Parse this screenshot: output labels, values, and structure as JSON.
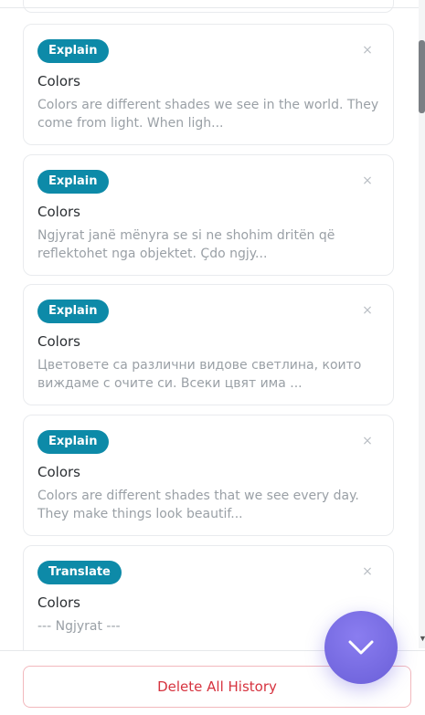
{
  "history": {
    "items": [
      {
        "badge": "Explain",
        "title": "Colors",
        "snippet": "Colors are different shades we see in the world. They come from light. When ligh...",
        "close_glyph": "×"
      },
      {
        "badge": "Explain",
        "title": "Colors",
        "snippet": "Ngjyrat janë mënyra se si ne shohim dritën që reflektohet nga objektet. Çdo ngjy...",
        "close_glyph": "×"
      },
      {
        "badge": "Explain",
        "title": "Colors",
        "snippet": "Цветовете са различни видове светлина, които виждаме с очите си. Всеки цвят има ...",
        "close_glyph": "×"
      },
      {
        "badge": "Explain",
        "title": "Colors",
        "snippet": "Colors are different shades that we see every day. They make things look beautif...",
        "close_glyph": "×"
      },
      {
        "badge": "Translate",
        "title": "Colors",
        "snippet": "--- Ngjyrat ---",
        "close_glyph": "×"
      }
    ]
  },
  "footer": {
    "delete_all_label": "Delete All History"
  },
  "icons": {
    "fab": "chevron-down-icon",
    "close": "close-icon",
    "scroll_down": "scroll-down-arrow-icon"
  },
  "colors": {
    "badge_bg": "#0d8aa8",
    "fab": "#7b6fe6",
    "delete_text": "#d6333f",
    "delete_border": "#f2b8bd"
  }
}
